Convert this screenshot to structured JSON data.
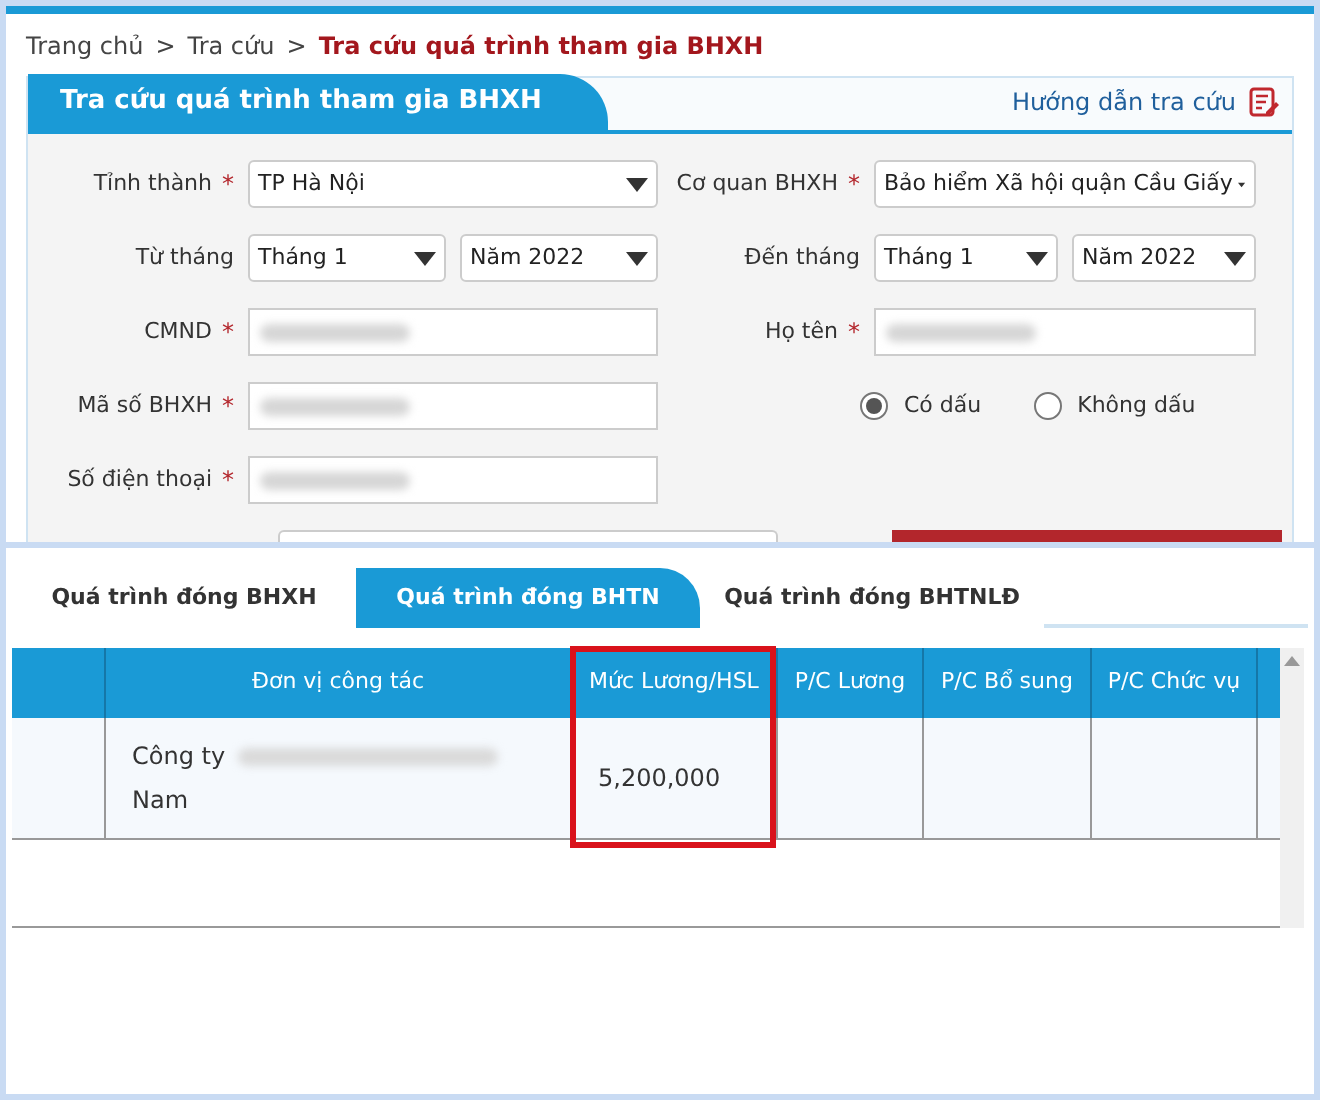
{
  "breadcrumb": [
    {
      "label": "Trang chủ",
      "separator": ">",
      "current": false
    },
    {
      "label": "Tra cứu",
      "separator": ">",
      "current": false
    },
    {
      "label": "Tra cứu quá trình tham gia BHXH",
      "current": true
    }
  ],
  "panel": {
    "title": "Tra cứu quá trình tham gia BHXH",
    "help_link": "Hướng dẫn tra cứu"
  },
  "form_rows": [
    {
      "fields": [
        {
          "kind": "select",
          "label": "Tỉnh thành",
          "required_mark": "*",
          "values": [
            "TP Hà Nội"
          ]
        },
        {
          "kind": "select",
          "label": "Cơ quan BHXH",
          "required_mark": "*",
          "values": [
            "Bảo hiểm Xã hội quận Cầu Giấy"
          ]
        }
      ]
    },
    {
      "fields": [
        {
          "kind": "select",
          "label": "Từ tháng",
          "values": [
            "Tháng 1",
            "Năm 2022"
          ]
        },
        {
          "kind": "select",
          "label": "Đến tháng",
          "values": [
            "Tháng 1",
            "Năm 2022"
          ]
        }
      ]
    },
    {
      "fields": [
        {
          "kind": "redacted",
          "label": "CMND",
          "required_mark": "*"
        },
        {
          "kind": "redacted",
          "label": "Họ tên",
          "required_mark": "*"
        }
      ]
    },
    {
      "fields": [
        {
          "kind": "redacted",
          "label": "Mã số BHXH",
          "required_mark": "*"
        },
        {
          "kind": "radios",
          "options": [
            {
              "label": "Có dấu",
              "selected": true
            },
            {
              "label": "Không dấu",
              "selected": false
            }
          ]
        }
      ]
    },
    {
      "fields": [
        {
          "kind": "redacted",
          "label": "Số điện thoại",
          "required_mark": "*"
        }
      ]
    }
  ],
  "result_tabs": [
    {
      "label": "Quá trình đóng BHXH",
      "selected": false
    },
    {
      "label": "Quá trình đóng BHTN",
      "selected": true
    },
    {
      "label": "Quá trình đóng BHTNLĐ",
      "selected": false
    }
  ],
  "table": {
    "columns": [
      {
        "label": "Đơn vị công tác",
        "highlighted": false
      },
      {
        "label": "Mức Lương/HSL",
        "highlighted": true
      },
      {
        "label": "P/C Lương",
        "highlighted": false
      },
      {
        "label": "P/C Bổ sung",
        "highlighted": false
      },
      {
        "label": "P/C Chức vụ",
        "highlighted": false
      }
    ],
    "rows": [
      {
        "unit_start": "Công ty",
        "unit_end": "Nam",
        "salary": "5,200,000"
      }
    ]
  }
}
